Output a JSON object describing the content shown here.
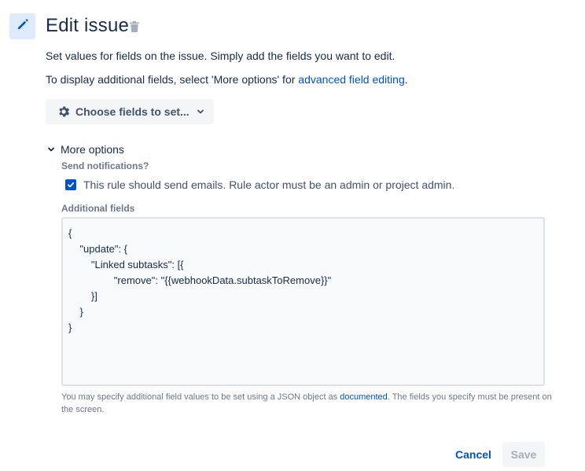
{
  "header": {
    "title": "Edit issue",
    "icon": "pencil-icon",
    "delete_icon": "trash-icon",
    "icon_bg_color": "#deebff"
  },
  "description": {
    "line1": "Set values for fields on the issue. Simply add the fields you want to edit.",
    "line2_prefix": "To display additional fields, select 'More options' for ",
    "line2_link": "advanced field editing",
    "line2_suffix": "."
  },
  "choose_fields": {
    "label": "Choose fields to set...",
    "icon": "gear-icon",
    "chevron": "chevron-down-icon"
  },
  "more_options": {
    "label": "More options",
    "expanded": true
  },
  "notifications": {
    "label": "Send notifications?",
    "checkbox_label": "This rule should send emails. Rule actor must be an admin or project admin.",
    "checked": true
  },
  "additional_fields": {
    "label": "Additional fields",
    "value": "{\n    \"update\": {\n        \"Linked subtasks\": [{\n                \"remove\": \"{{webhookData.subtaskToRemove}}\"\n        }]\n    }\n}"
  },
  "hint": {
    "prefix": "You may specify additional field values to be set using a JSON object as ",
    "link": "documented",
    "suffix": ". The fields you specify must be present on the screen."
  },
  "footer": {
    "cancel_label": "Cancel",
    "save_label": "Save"
  },
  "colors": {
    "link": "#0052cc",
    "checkbox": "#0052cc",
    "text": "#172b4d",
    "muted": "#6b778c"
  }
}
